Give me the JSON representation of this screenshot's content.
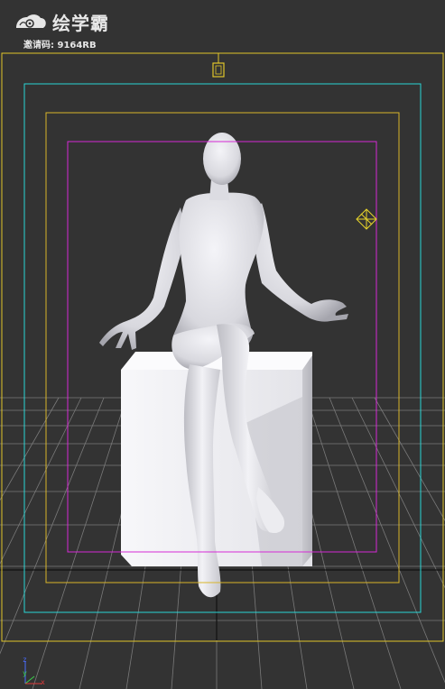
{
  "brand": {
    "logo_icon": "cloud-swirl-logo",
    "name": "绘学霸"
  },
  "invite": {
    "text": "邀请码: 9164RB"
  },
  "viewport": {
    "background": "#333333",
    "safe_frame_outer_color": "#e1c62a",
    "safe_frame_action_color": "#2ad6d6",
    "safe_frame_title_color": "#d9b62a",
    "safe_frame_user_color": "#d62ad6",
    "grid_color": "#7a7a7a",
    "model_color": "#e6e6ec",
    "pedestal_color": "#f2f2f5"
  },
  "gizmo": {
    "axes": [
      {
        "label": "z",
        "color": "#4a6cff"
      },
      {
        "label": "y",
        "color": "#3bd14a"
      },
      {
        "label": "x",
        "color": "#e03b3b"
      }
    ]
  }
}
